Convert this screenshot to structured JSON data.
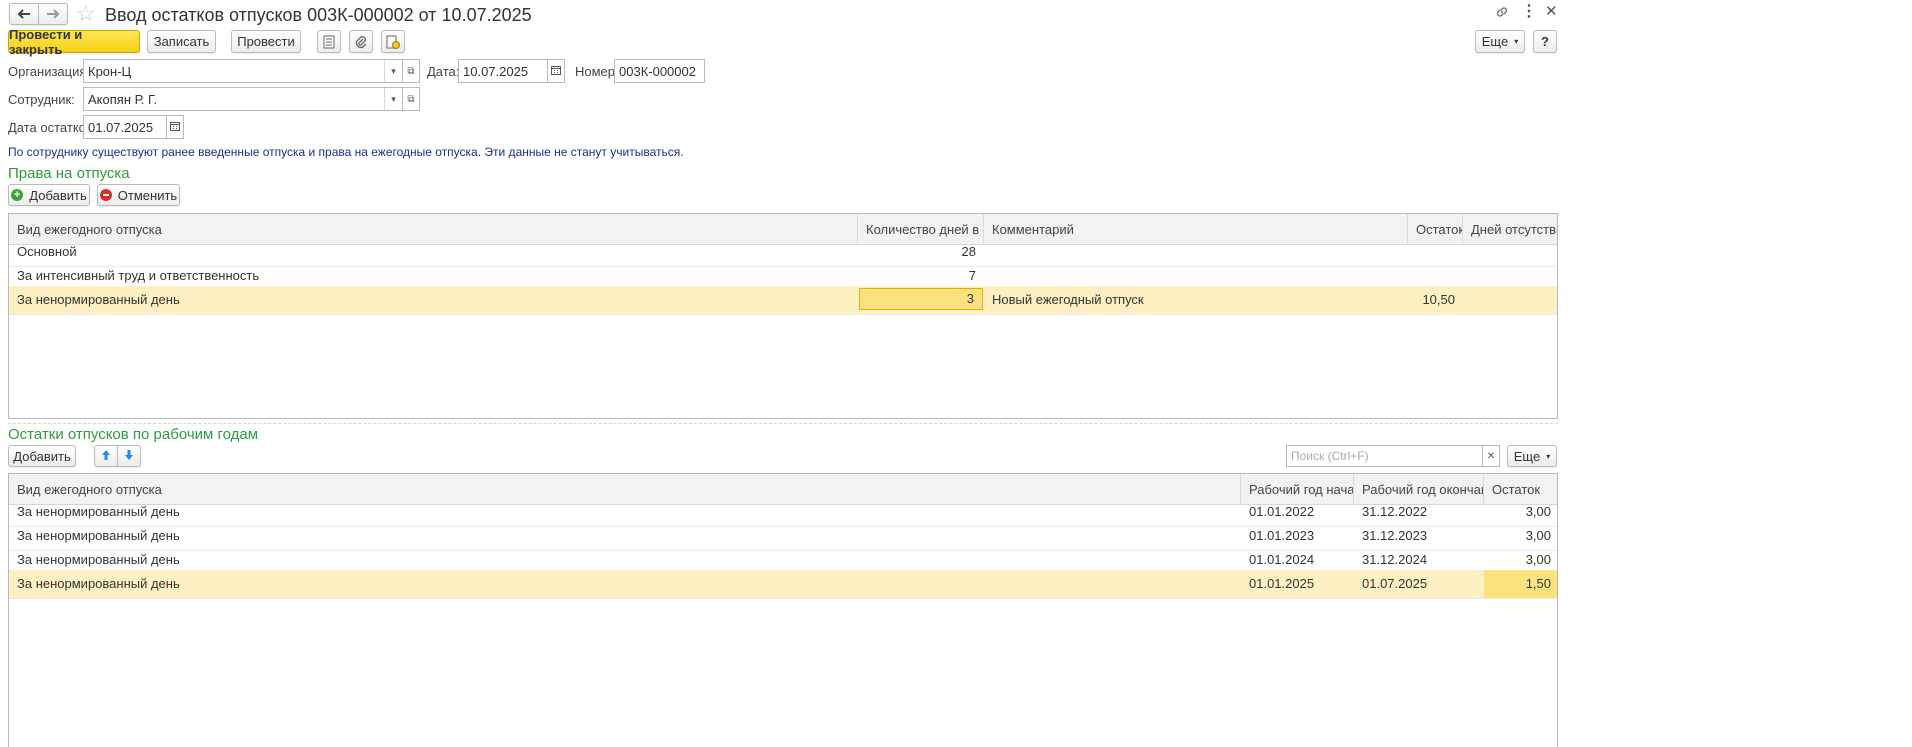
{
  "window": {
    "title": "Ввод остатков отпусков 003К-000002 от 10.07.2025"
  },
  "toolbar": {
    "post_close_label": "Провести и закрыть",
    "save_label": "Записать",
    "post_label": "Провести",
    "more_label": "Еще",
    "help_label": "?"
  },
  "form": {
    "org_label": "Организация:",
    "org_value": "Крон-Ц",
    "date_label": "Дата:",
    "date_value": "10.07.2025",
    "number_label": "Номер:",
    "number_value": "003К-000002",
    "employee_label": "Сотрудник:",
    "employee_value": "Акопян Р. Г.",
    "balance_date_label": "Дата остатков:",
    "balance_date_value": "01.07.2025",
    "info_message": "По сотруднику существуют ранее введенные отпуска и права на ежегодные отпуска. Эти данные не станут учитываться."
  },
  "rights_section": {
    "title": "Права на отпуска",
    "add_label": "Добавить",
    "cancel_label": "Отменить",
    "columns": [
      "Вид ежегодного отпуска",
      "Количество дней в год",
      "Комментарий",
      "Остаток",
      "Дней отсутствия"
    ],
    "rows": [
      {
        "type": "Основной",
        "days": "28",
        "comment": "",
        "remainder": "",
        "absence": ""
      },
      {
        "type": "За интенсивный труд и ответственность",
        "days": "7",
        "comment": "",
        "remainder": "",
        "absence": ""
      },
      {
        "type": "За ненормированный день",
        "days": "3",
        "comment": "Новый ежегодный отпуск",
        "remainder": "10,50",
        "absence": ""
      }
    ]
  },
  "balances_section": {
    "title": "Остатки отпусков по рабочим годам",
    "add_label": "Добавить",
    "search_placeholder": "Поиск (Ctrl+F)",
    "more_label": "Еще",
    "columns": [
      "Вид ежегодного отпуска",
      "Рабочий год начало",
      "Рабочий год окончание",
      "Остаток"
    ],
    "rows": [
      {
        "type": "За ненормированный день",
        "start": "01.01.2022",
        "end": "31.12.2022",
        "remainder": "3,00"
      },
      {
        "type": "За ненормированный день",
        "start": "01.01.2023",
        "end": "31.12.2023",
        "remainder": "3,00"
      },
      {
        "type": "За ненормированный день",
        "start": "01.01.2024",
        "end": "31.12.2024",
        "remainder": "3,00"
      },
      {
        "type": "За ненормированный день",
        "start": "01.01.2025",
        "end": "01.07.2025",
        "remainder": "1,50"
      }
    ]
  },
  "colors": {
    "accent_yellow": "#f5d11a",
    "section_green": "#2e9b3e",
    "info_blue": "#1a2e8a",
    "selected_row": "#fdf0c2"
  }
}
